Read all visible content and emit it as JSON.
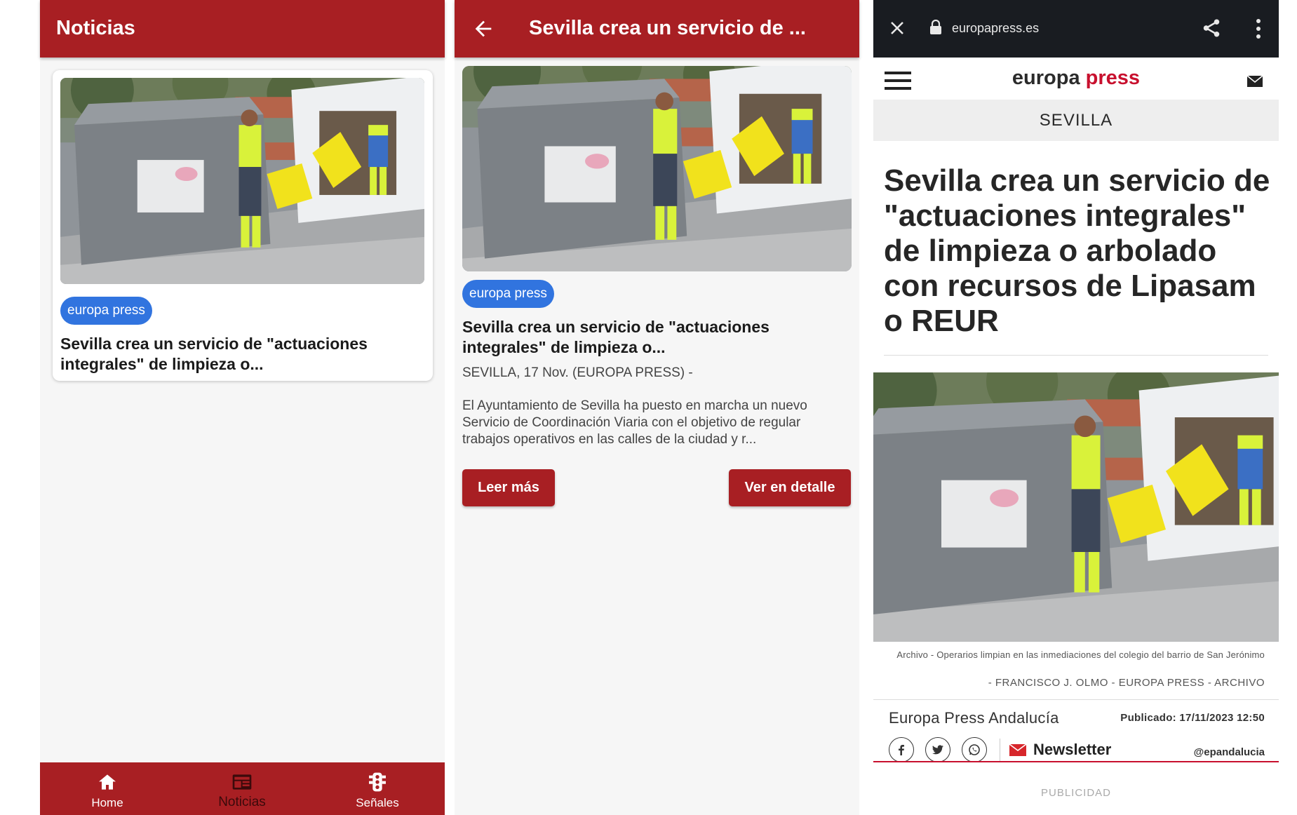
{
  "colors": {
    "app_red": "#a81f23",
    "chip_blue": "#3174df",
    "browser_bar": "#191c21",
    "ep_red": "#c8102e"
  },
  "list_screen": {
    "title": "Noticias",
    "card": {
      "source": "europa press",
      "title": "Sevilla crea un servicio de \"actuaciones integrales\" de limpieza o..."
    },
    "bottom_nav": [
      {
        "label": "Home",
        "icon": "home-icon"
      },
      {
        "label": "Noticias",
        "icon": "newspaper-icon",
        "active": true
      },
      {
        "label": "Señales",
        "icon": "traffic-light-icon"
      }
    ]
  },
  "detail_screen": {
    "title": "Sevilla crea un servicio de ...",
    "source": "europa press",
    "headline": "Sevilla crea un servicio de \"actuaciones integrales\" de limpieza o...",
    "dateline": "SEVILLA, 17 Nov. (EUROPA PRESS) -",
    "body": "El Ayuntamiento de Sevilla ha puesto en marcha un nuevo Servicio de Coordinación Viaria con el objetivo de regular trabajos operativos en las calles de la ciudad y r...",
    "read_more": "Leer más",
    "view_detail": "Ver en detalle"
  },
  "browser_screen": {
    "url": "europapress.es",
    "logo_part1": "europa",
    "logo_part2": "press",
    "section": "SEVILLA",
    "article_title": "Sevilla crea un servicio de \"actuaciones integrales\" de limpieza o arbolado con recursos de Lipasam o REUR",
    "caption": "Archivo - Operarios limpian en las inmediaciones del colegio del barrio de San Jerónimo",
    "credit": "- FRANCISCO J. OLMO - EUROPA PRESS - ARCHIVO",
    "author": "Europa Press Andalucía",
    "published": "Publicado: 17/11/2023 12:50",
    "newsletter": "Newsletter",
    "handle": "@epandalucia",
    "publicidad": "PUBLICIDAD"
  }
}
